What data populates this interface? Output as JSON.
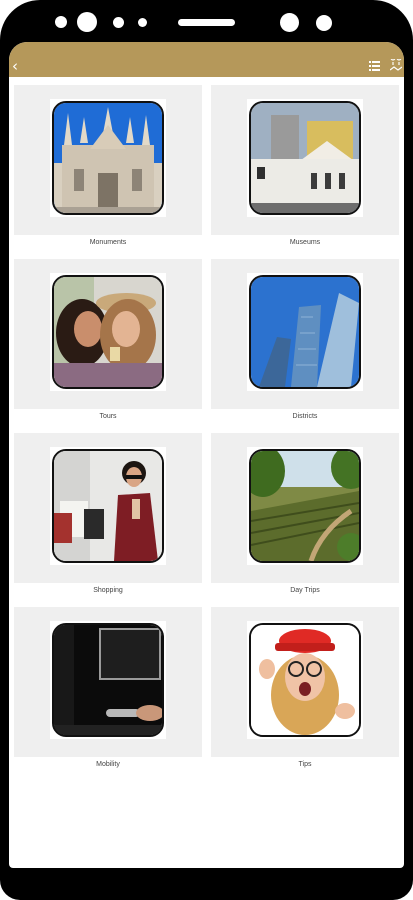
{
  "header": {
    "background_color": "#b5985a",
    "back_icon": "chevron-left-icon",
    "list_icon": "list-icon",
    "map_icon": "map-icon"
  },
  "categories": [
    {
      "label": "Monuments",
      "image": "cathedral-photo"
    },
    {
      "label": "Museums",
      "image": "museum-building-photo"
    },
    {
      "label": "Tours",
      "image": "friends-smartphone-photo"
    },
    {
      "label": "Districts",
      "image": "skyscrapers-photo"
    },
    {
      "label": "Shopping",
      "image": "shopping-woman-photo"
    },
    {
      "label": "Day Trips",
      "image": "vineyard-photo"
    },
    {
      "label": "Mobility",
      "image": "car-door-photo"
    },
    {
      "label": "Tips",
      "image": "surprised-woman-photo"
    }
  ]
}
